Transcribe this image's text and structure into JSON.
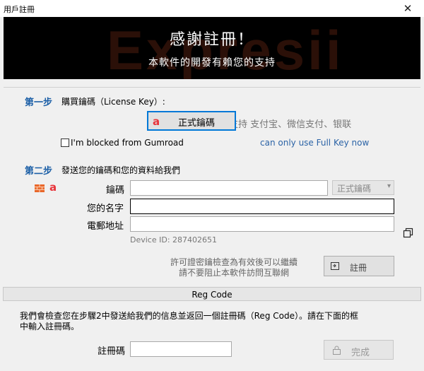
{
  "window": {
    "title": "用戶註冊",
    "close": "✕"
  },
  "banner": {
    "watermark": "Expresii",
    "headline": "感謝註冊！",
    "subheadline": "本軟件的開發有賴您的支持"
  },
  "step1": {
    "label": "第一步",
    "text": "購買鑰碼（License Key）:",
    "buy_button": "正式鑰碼",
    "buy_button_icon": "a",
    "payment_text": "支持 支付宝、微信支付、银联",
    "blocked_label": "I'm blocked from Gumroad",
    "blocked_checked": false,
    "full_key_note": "can only use Full Key now"
  },
  "step2": {
    "label": "第二步",
    "text": "發送您的鑰碼和您的資料給我們",
    "key_label": "鑰碼",
    "key_value": "",
    "key_type_selected": "正式鑰碼",
    "name_label": "您的名字",
    "name_value": "",
    "email_label": "電郵地址",
    "email_value": "",
    "device_id": "Device ID: 287402651",
    "permission_line1": "許可證密鑰檢查為有效後可以繼續",
    "permission_line2": "請不要阻止本軟件訪問互聯網",
    "register_button": "註冊"
  },
  "reg_code": {
    "header": "Reg Code",
    "instruction_line1": "我們會檢查您在步驟2中發送給我們的信息並返回一個註冊碼（Reg Code）。請在下面的框",
    "instruction_line2": "中輸入註冊碼。",
    "field_label": "註冊碼",
    "field_value": "",
    "finish_button": "完成"
  },
  "colors": {
    "accent": "#0078d7",
    "step": "#1a5ea6",
    "brand_red": "#e8333a",
    "banner_bg": "#000000"
  }
}
